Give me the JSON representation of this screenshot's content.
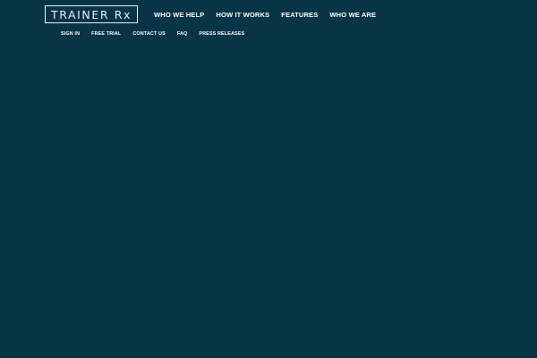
{
  "brand": {
    "logo_text": "TRAINER Rx"
  },
  "colors": {
    "background": "#083447",
    "text": "#ffffff"
  },
  "main_nav": {
    "items": [
      {
        "label": "WHO WE HELP"
      },
      {
        "label": "HOW IT WORKS"
      },
      {
        "label": "FEATURES"
      },
      {
        "label": "WHO WE ARE"
      }
    ]
  },
  "sub_nav": {
    "items": [
      {
        "label": "SIGN IN"
      },
      {
        "label": "FREE TRIAL"
      },
      {
        "label": "CONTACT US"
      },
      {
        "label": "FAQ"
      },
      {
        "label": "PRESS RELEASES"
      }
    ]
  }
}
